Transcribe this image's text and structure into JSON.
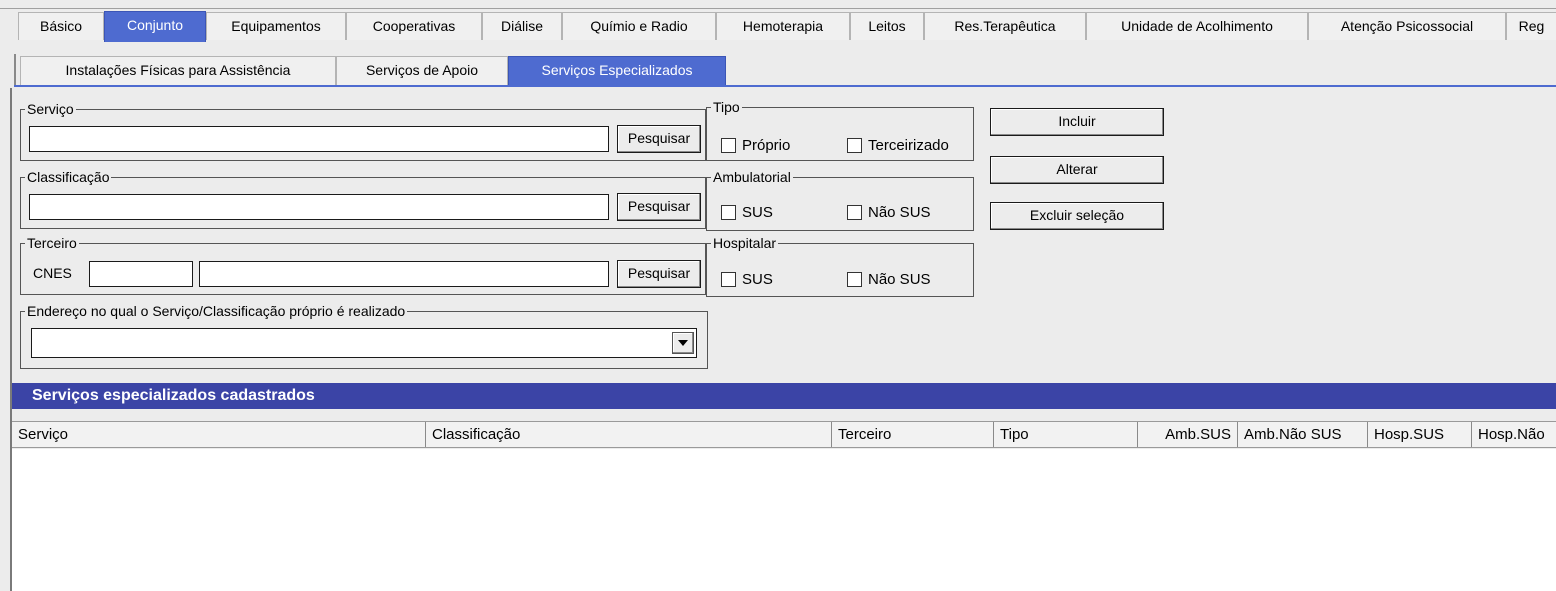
{
  "tabs_main": [
    {
      "label": "Básico",
      "active": false
    },
    {
      "label": "Conjunto",
      "active": true
    },
    {
      "label": "Equipamentos",
      "active": false
    },
    {
      "label": "Cooperativas",
      "active": false
    },
    {
      "label": "Diálise",
      "active": false
    },
    {
      "label": "Químio e Radio",
      "active": false
    },
    {
      "label": "Hemoterapia",
      "active": false
    },
    {
      "label": "Leitos",
      "active": false
    },
    {
      "label": "Res.Terapêutica",
      "active": false
    },
    {
      "label": "Unidade de Acolhimento",
      "active": false
    },
    {
      "label": "Atenção Psicossocial",
      "active": false
    },
    {
      "label": "Reg",
      "active": false
    }
  ],
  "tabs_sub": [
    {
      "label": "Instalações Físicas para Assistência",
      "active": false
    },
    {
      "label": "Serviços de Apoio",
      "active": false
    },
    {
      "label": "Serviços Especializados",
      "active": true
    }
  ],
  "form": {
    "servico": {
      "legend": "Serviço",
      "value": "",
      "search_label": "Pesquisar"
    },
    "classificacao": {
      "legend": "Classificação",
      "value": "",
      "search_label": "Pesquisar"
    },
    "terceiro": {
      "legend": "Terceiro",
      "cnes_label": "CNES",
      "cnes_value": "",
      "name_value": "",
      "search_label": "Pesquisar"
    },
    "endereco": {
      "legend": "Endereço no qual o Serviço/Classificação próprio é realizado",
      "selected": ""
    },
    "tipo": {
      "legend": "Tipo",
      "option1": "Próprio",
      "option2": "Terceirizado"
    },
    "ambulatorial": {
      "legend": "Ambulatorial",
      "option1": "SUS",
      "option2": "Não SUS"
    },
    "hospitalar": {
      "legend": "Hospitalar",
      "option1": "SUS",
      "option2": "Não SUS"
    }
  },
  "actions": {
    "incluir": "Incluir",
    "alterar": "Alterar",
    "excluir": "Excluir seleção"
  },
  "grid": {
    "title": "Serviços especializados cadastrados",
    "columns": [
      "Serviço",
      "Classificação",
      "Terceiro",
      "Tipo",
      "Amb.SUS",
      "Amb.Não SUS",
      "Hosp.SUS",
      "Hosp.Não"
    ],
    "rows": []
  },
  "colors": {
    "active_tab": "#4e6bd0",
    "section_header": "#3b44a6"
  }
}
